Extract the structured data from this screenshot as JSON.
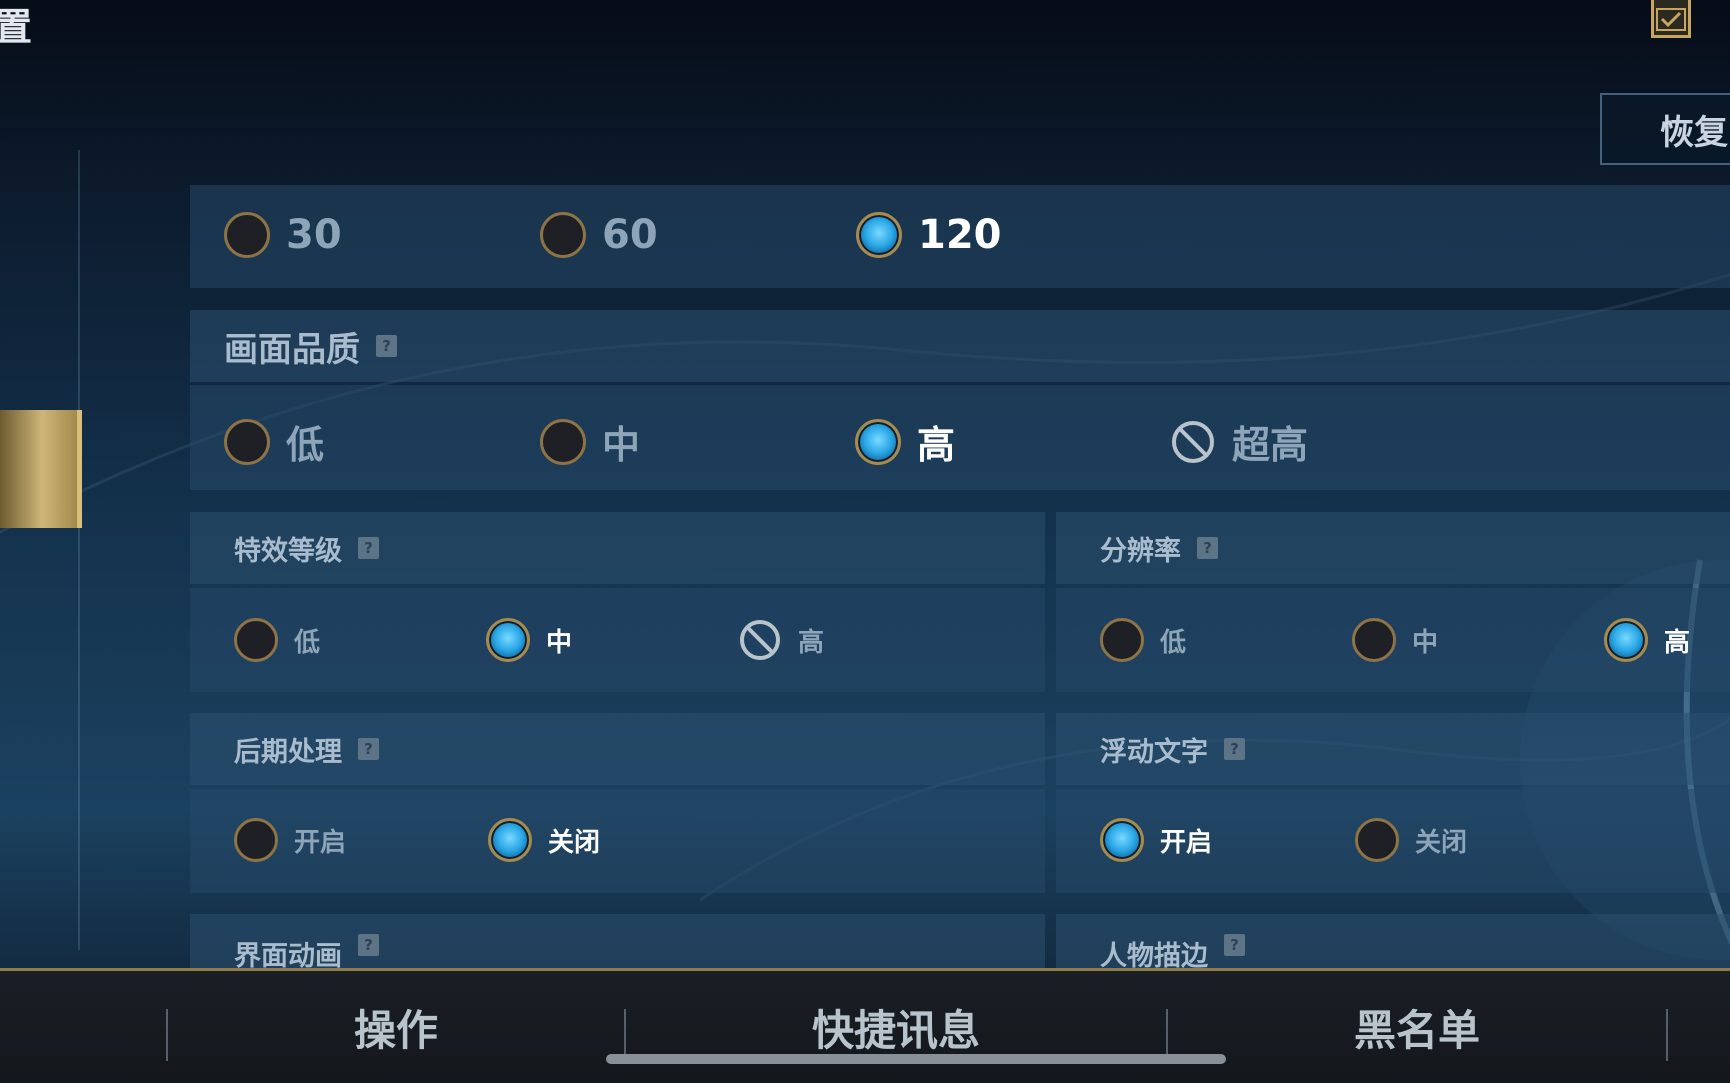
{
  "header": {
    "title_fragment": "置",
    "confirm_icon": "checkbox-check-icon",
    "restore_label": "恢复"
  },
  "framerate": {
    "options": [
      {
        "label": "30",
        "selected": false
      },
      {
        "label": "60",
        "selected": false
      },
      {
        "label": "120",
        "selected": true
      }
    ]
  },
  "quality": {
    "title": "画面品质",
    "help_glyph": "?",
    "options": [
      {
        "label": "低",
        "state": "off"
      },
      {
        "label": "中",
        "state": "off"
      },
      {
        "label": "高",
        "state": "on"
      },
      {
        "label": "超高",
        "state": "disabled"
      }
    ]
  },
  "effects": {
    "title": "特效等级",
    "options": [
      {
        "label": "低",
        "state": "off"
      },
      {
        "label": "中",
        "state": "on"
      },
      {
        "label": "高",
        "state": "disabled"
      }
    ]
  },
  "resolution": {
    "title": "分辨率",
    "options": [
      {
        "label": "低",
        "state": "off"
      },
      {
        "label": "中",
        "state": "off"
      },
      {
        "label": "高",
        "state": "on"
      }
    ]
  },
  "postprocess": {
    "title": "后期处理",
    "options": [
      {
        "label": "开启",
        "state": "off"
      },
      {
        "label": "关闭",
        "state": "on"
      }
    ]
  },
  "floating_text": {
    "title": "浮动文字",
    "options": [
      {
        "label": "开启",
        "state": "on"
      },
      {
        "label": "关闭",
        "state": "off"
      }
    ]
  },
  "ui_animation": {
    "title": "界面动画"
  },
  "character_outline": {
    "title": "人物描边"
  },
  "bottom_tabs": [
    {
      "label": "操作"
    },
    {
      "label": "快捷讯息"
    },
    {
      "label": "黑名单"
    }
  ],
  "colors": {
    "accent_gold": "#c9a660",
    "selected_blue": "#29a7e6",
    "panel_bg": "#264868"
  }
}
